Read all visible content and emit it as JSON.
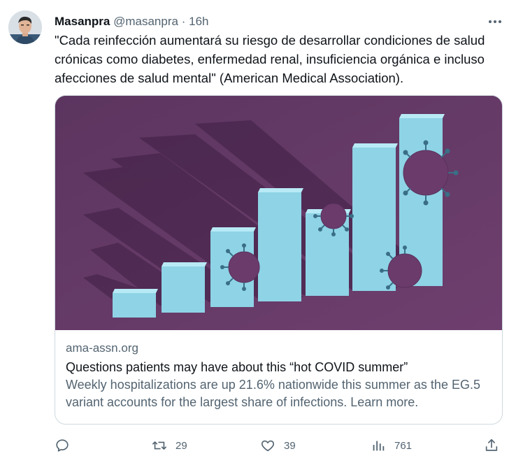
{
  "tweet": {
    "author_name": "Masanpra",
    "author_handle": "@masanpra",
    "separator": "·",
    "time": "16h",
    "text": "\"Cada reinfección aumentará su riesgo de desarrollar condiciones de salud crónicas como diabetes, enfermedad renal, insuficiencia orgánica e incluso afecciones de salud mental\" (American Medical Association).",
    "more_icon": "more-dots-icon"
  },
  "card": {
    "domain": "ama-assn.org",
    "title": "Questions patients may have about this “hot COVID summer”",
    "description": "Weekly hospitalizations are up 21.6% nationwide this summer as the EG.5 variant accounts for the largest share of infections. Learn more.",
    "image_colors": {
      "background": "#6b3c6b",
      "bars": "#8ed3e6",
      "shadow": "#3f1f44"
    }
  },
  "actions": {
    "reply": {
      "icon": "reply-icon",
      "count": ""
    },
    "retweet": {
      "icon": "retweet-icon",
      "count": "29"
    },
    "like": {
      "icon": "heart-icon",
      "count": "39"
    },
    "views": {
      "icon": "views-bar-icon",
      "count": "761"
    },
    "share": {
      "icon": "share-icon",
      "count": ""
    }
  }
}
